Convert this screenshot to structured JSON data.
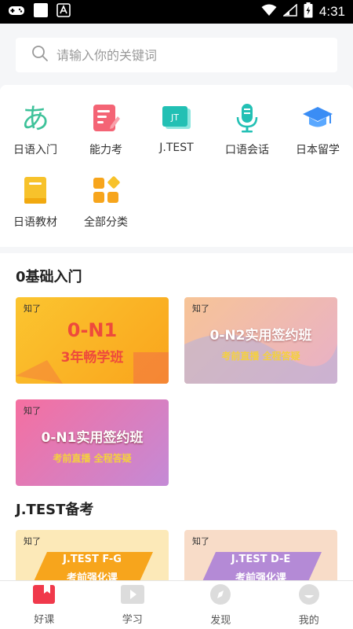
{
  "status_bar": {
    "time": "4:31"
  },
  "search": {
    "placeholder": "请输入你的关键词"
  },
  "categories": [
    {
      "label": "日语入门",
      "icon": "hiragana-a-icon"
    },
    {
      "label": "能力考",
      "icon": "notes-icon"
    },
    {
      "label": "J.TEST",
      "icon": "jtest-icon"
    },
    {
      "label": "口语会话",
      "icon": "microphone-icon"
    },
    {
      "label": "日本留学",
      "icon": "graduation-cap-icon"
    },
    {
      "label": "日语教材",
      "icon": "book-icon"
    },
    {
      "label": "全部分类",
      "icon": "grid-icon"
    }
  ],
  "sections": [
    {
      "title": "0基础入门",
      "cards": [
        {
          "logo": "知了",
          "line1": "0-N1",
          "line2": "3年畅学班"
        },
        {
          "logo": "知了",
          "line1": "0-N2实用签约班",
          "line2": "考前直播 全程答疑"
        },
        {
          "logo": "知了",
          "line1": "0-N1实用签约班",
          "line2": "考前直播 全程答疑"
        }
      ]
    },
    {
      "title": "J.TEST备考",
      "cards": [
        {
          "logo": "知了",
          "line1": "J.TEST F-G",
          "line2": "考前强化课"
        },
        {
          "logo": "知了",
          "line1": "J.TEST D-E",
          "line2": "考前强化课"
        }
      ]
    }
  ],
  "tabs": [
    {
      "label": "好课",
      "icon": "book-icon"
    },
    {
      "label": "学习",
      "icon": "play-icon"
    },
    {
      "label": "发现",
      "icon": "compass-icon"
    },
    {
      "label": "我的",
      "icon": "profile-icon"
    }
  ],
  "colors": {
    "accent": "#f0394b",
    "teal": "#22c0b4",
    "orange": "#f7a51c"
  }
}
